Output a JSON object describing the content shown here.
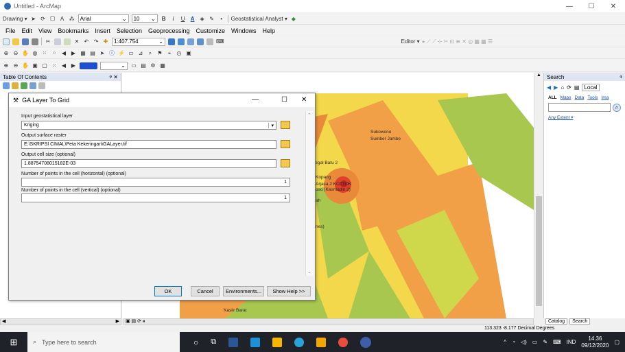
{
  "window": {
    "title": "Untitled - ArcMap",
    "minimize": "—",
    "restore": "☐",
    "close": "✕"
  },
  "toolbar1": {
    "drawing_label": "Drawing ▾",
    "font_name": "Arial",
    "font_size": "10",
    "bold": "B",
    "italic": "I",
    "underline": "U",
    "font_color": "A",
    "geostat_label": "Geostatistical Analyst ▾"
  },
  "menu": [
    "File",
    "Edit",
    "View",
    "Bookmarks",
    "Insert",
    "Selection",
    "Geoprocessing",
    "Customize",
    "Windows",
    "Help"
  ],
  "toolbar2": {
    "scale": "1:407.754",
    "editor_label": "Editor ▾"
  },
  "toc": {
    "title": "Table Of Contents",
    "pin": "ᵠ ✕"
  },
  "dialog": {
    "title": "GA Layer To Grid",
    "fields": [
      {
        "label": "Input geostatistical layer",
        "value": "Kriging"
      },
      {
        "label": "Output surface raster",
        "value": "E:\\SKRIPSI CIMAL\\Peta Kekeringan\\GALayer.tif"
      },
      {
        "label": "Output cell size (optional)",
        "value": "1.88754708015182E-03"
      },
      {
        "label": "Number of points in the cell (horizontal) (optional)",
        "value": "1"
      },
      {
        "label": "Number of points in the cell (vertical) (optional)",
        "value": "1"
      }
    ],
    "buttons": {
      "ok": "OK",
      "cancel": "Cancel",
      "environments": "Environments...",
      "help": "Show Help >>"
    }
  },
  "map": {
    "labels": [
      "Sukowono",
      "Sumber Jambe",
      "Tegal Batu 2",
      "Kopang",
      "Arjasa 2 KOTTOK",
      "oso (Kasmadin 2)",
      "ah",
      "nes)",
      "Kasilr Barat"
    ]
  },
  "search": {
    "title": "Search",
    "local": "Local",
    "tabs": [
      "ALL",
      "Maps",
      "Data",
      "Tools",
      "Ima"
    ],
    "any_extent": "Any Extent ▾"
  },
  "status": {
    "coords": "113.323  -8.177 Decimal Degrees",
    "catalog_tab": "Catalog",
    "search_tab": "Search"
  },
  "taskbar": {
    "search_placeholder": "Type here to search",
    "lang": "IND",
    "time": "14.36",
    "date": "09/12/2020"
  },
  "colors": {
    "map_yellow": "#f2d84a",
    "map_orange": "#f1a047",
    "map_green": "#a8c74f",
    "map_red": "#e0402b"
  }
}
